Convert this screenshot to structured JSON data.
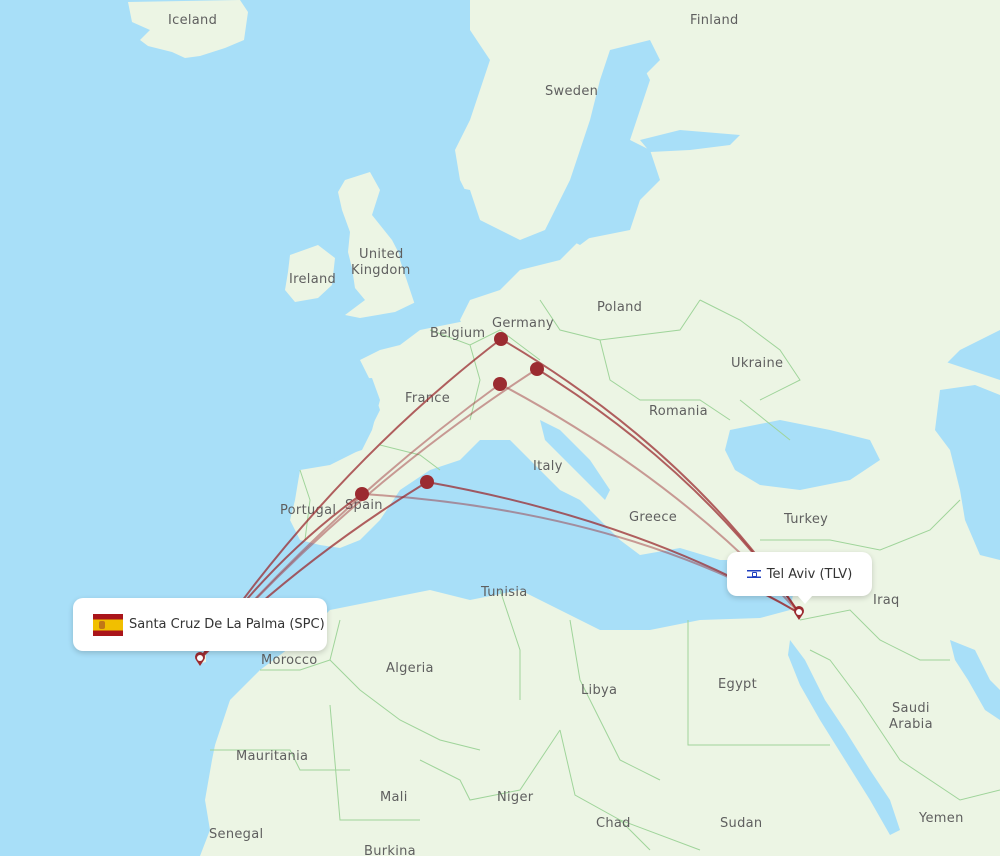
{
  "map": {
    "colors": {
      "water": "#a8dff8",
      "land": "#ecf5e4",
      "border": "#9fd49a",
      "route": "#9b2b30",
      "label": "#5f5f5f"
    },
    "country_labels": [
      {
        "name": "Iceland"
      },
      {
        "name": "Finland"
      },
      {
        "name": "Sweden"
      },
      {
        "name": "United"
      },
      {
        "name": "Kingdom"
      },
      {
        "name": "Ireland"
      },
      {
        "name": "Belgium"
      },
      {
        "name": "Germany"
      },
      {
        "name": "Poland"
      },
      {
        "name": "Ukraine"
      },
      {
        "name": "France"
      },
      {
        "name": "Romania"
      },
      {
        "name": "Italy"
      },
      {
        "name": "Portugal"
      },
      {
        "name": "Spain"
      },
      {
        "name": "Turkey"
      },
      {
        "name": "Greece"
      },
      {
        "name": "Tunisia"
      },
      {
        "name": "Iraq"
      },
      {
        "name": "Morocco"
      },
      {
        "name": "Algeria"
      },
      {
        "name": "Libya"
      },
      {
        "name": "Egypt"
      },
      {
        "name": "Saudi"
      },
      {
        "name": "Arabia"
      },
      {
        "name": "Mauritania"
      },
      {
        "name": "Mali"
      },
      {
        "name": "Niger"
      },
      {
        "name": "Chad"
      },
      {
        "name": "Sudan"
      },
      {
        "name": "Yemen"
      },
      {
        "name": "Senegal"
      },
      {
        "name": "Burkina"
      }
    ]
  },
  "origin": {
    "name": "Santa Cruz De La Palma (SPC)",
    "flag": "spain-flag"
  },
  "destination": {
    "name": "Tel Aviv (TLV)",
    "flag": "israel-flag"
  },
  "hubs": [
    {
      "id": "hub-germany-north"
    },
    {
      "id": "hub-germany-south"
    },
    {
      "id": "hub-switzerland"
    },
    {
      "id": "hub-madrid"
    },
    {
      "id": "hub-barcelona"
    }
  ]
}
